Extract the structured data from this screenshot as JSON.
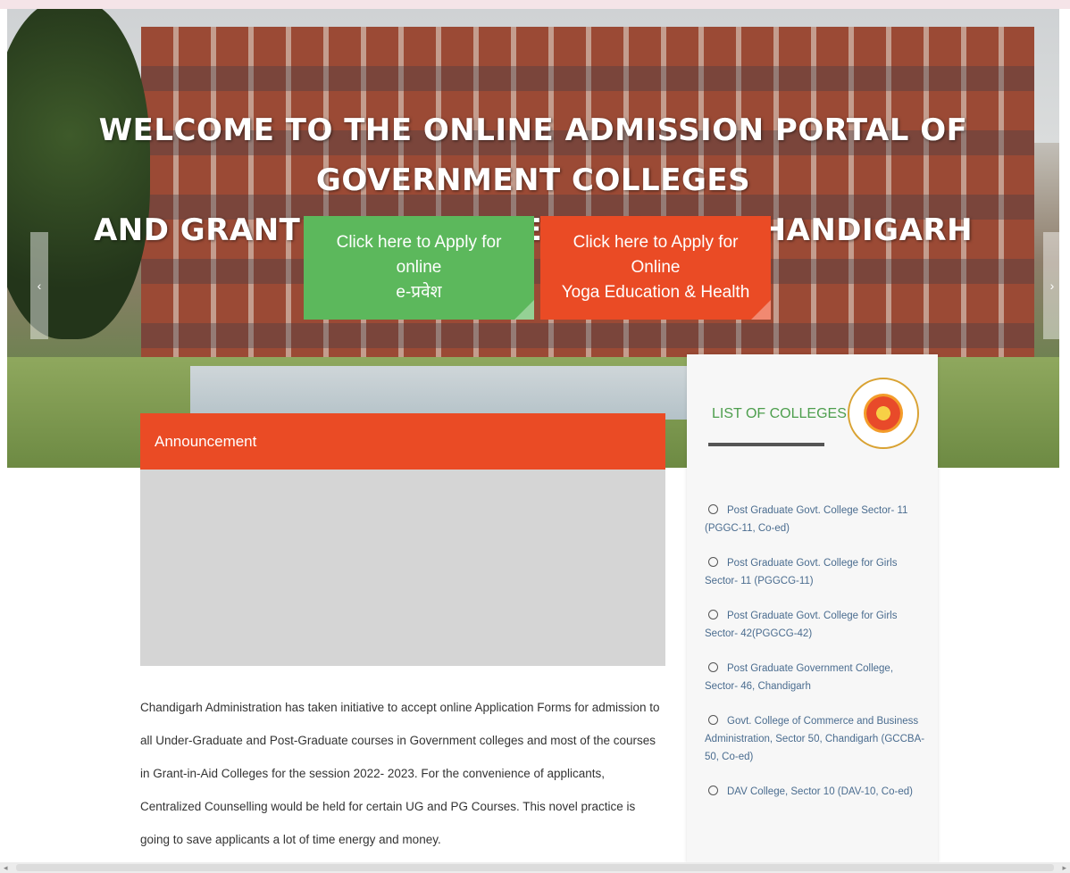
{
  "hero": {
    "title_line1": "WELCOME TO THE ONLINE ADMISSION PORTAL OF GOVERNMENT COLLEGES",
    "title_line2": "AND GRANT IN AID COLLEGES OF UT CHANDIGARH",
    "prev_label": "‹",
    "next_label": "›"
  },
  "cta": {
    "apply_online": {
      "line1": "Click here to Apply for online",
      "line2": "e-प्रवेश",
      "color": "#5cb85c"
    },
    "apply_yoga": {
      "line1": "Click here to Apply for Online",
      "line2": "Yoga Education & Health",
      "color": "#ea4b25"
    }
  },
  "announcement": {
    "heading": "Announcement"
  },
  "intro_text": "Chandigarh Administration has taken initiative to accept online Application Forms for admission to all Under-Graduate and Post-Graduate courses in Government colleges and most of the courses in Grant-in-Aid Colleges for the session 2022- 2023. For the convenience of applicants, Centralized Counselling would be held for certain UG and PG Courses. This novel practice is going to save applicants a lot of time energy and money.",
  "colleges": {
    "title": "LIST OF COLLEGES",
    "items": [
      "Post Graduate Govt. College Sector- 11 (PGGC-11, Co-ed)",
      "Post Graduate Govt. College for Girls Sector- 11 (PGGCG-11)",
      "Post Graduate Govt. College for Girls Sector- 42(PGGCG-42)",
      "Post Graduate Government College, Sector- 46, Chandigarh",
      "Govt. College of Commerce and Business Administration, Sector 50, Chandigarh (GCCBA-50, Co-ed)",
      "DAV College, Sector 10 (DAV-10, Co-ed)"
    ],
    "seal_icon": "yoga-education-seal-icon"
  },
  "colors": {
    "accent_orange": "#ea4b25",
    "accent_green": "#5cb85c",
    "link_blue": "#4a6c8f"
  }
}
